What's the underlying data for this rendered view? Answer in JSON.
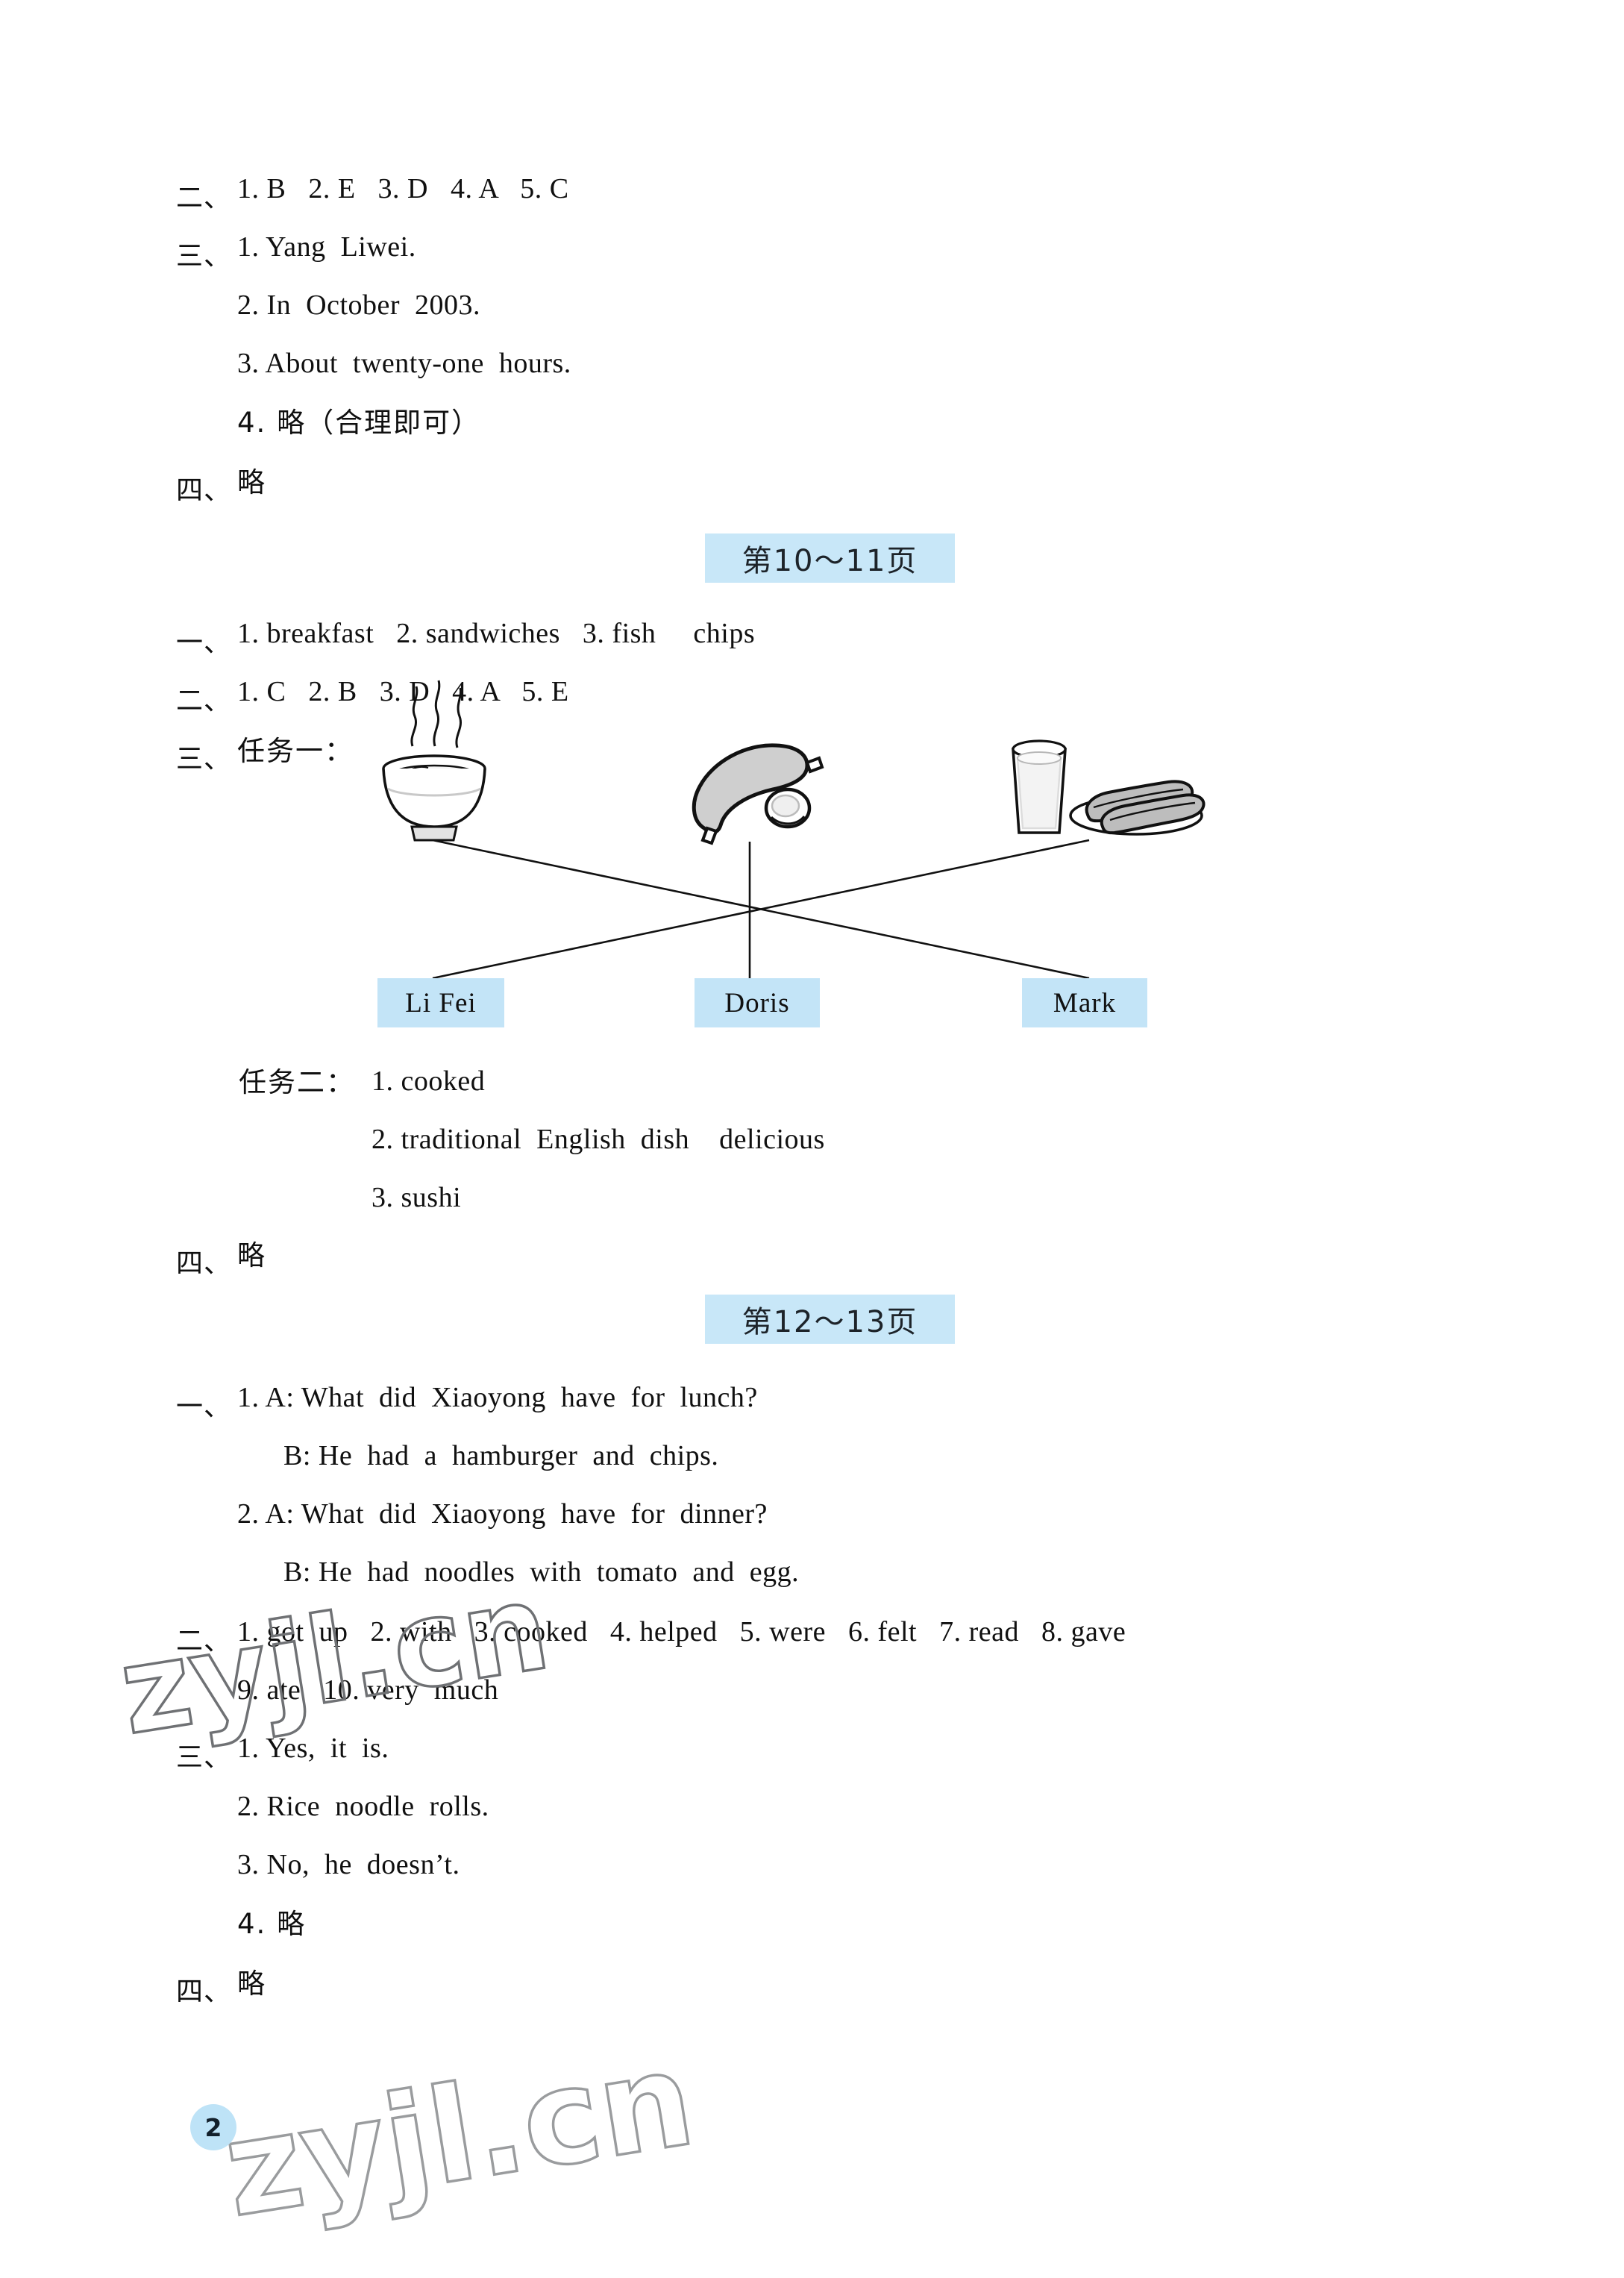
{
  "document": {
    "page_number": "2",
    "watermark_text": "zyjl.cn"
  },
  "section_top": {
    "lines": [
      {
        "marker": "二、",
        "text": "1. B   2. E   3. D   4. A   5. C"
      },
      {
        "marker": "三、",
        "text": "1. Yang  Liwei."
      },
      {
        "marker": "",
        "text": "2. In  October  2003."
      },
      {
        "marker": "",
        "text": "3. About  twenty-one  hours."
      },
      {
        "marker": "",
        "text": "4. 略（合理即可）"
      },
      {
        "marker": "四、",
        "text": "略"
      }
    ]
  },
  "page_heading_1": {
    "label": "第10～11页"
  },
  "section_10_11": {
    "line_1": {
      "marker": "一、",
      "text": "1. breakfast   2. sandwiches   3. fish     chips"
    },
    "line_2": {
      "marker": "二、",
      "text": "1. C   2. B   3. D   4. A   5. E"
    },
    "task_one_marker": "三、",
    "task_one_label": "任务一：",
    "food_items": [
      {
        "name": "noodle-soup-bowl",
        "label": "noodle soup bowl with steam"
      },
      {
        "name": "sausage-and-egg",
        "label": "sausage and fried egg"
      },
      {
        "name": "milk-and-dough-sticks",
        "label": "glass of milk and plate of fried dough sticks"
      }
    ],
    "name_chips": [
      {
        "name": "li-fei",
        "label": "Li  Fei"
      },
      {
        "name": "doris",
        "label": "Doris"
      },
      {
        "name": "mark",
        "label": "Mark"
      }
    ],
    "matching_lines": [
      {
        "from": "noodle-soup-bowl",
        "to": "mark"
      },
      {
        "from": "sausage-and-egg",
        "to": "doris"
      },
      {
        "from": "milk-and-dough-sticks",
        "to": "li-fei"
      }
    ],
    "task_two_label": "任务二：",
    "task_two_items": [
      "1. cooked",
      "2. traditional  English  dish    delicious",
      "3. sushi"
    ],
    "line_4": {
      "marker": "四、",
      "text": "略"
    }
  },
  "page_heading_2": {
    "label": "第12～13页"
  },
  "section_12_13": {
    "group_one_marker": "一、",
    "group_one": [
      "1. A: What  did  Xiaoyong  have  for  lunch?",
      "B: He  had  a  hamburger  and  chips.",
      "2. A: What  did  Xiaoyong  have  for  dinner?",
      "B: He  had  noodles  with  tomato  and  egg."
    ],
    "group_two_marker": "二、",
    "group_two": [
      "1. got  up   2. with   3. cooked   4. helped   5. were   6. felt   7. read   8. gave",
      "9. ate   10. very  much"
    ],
    "group_three_marker": "三、",
    "group_three": [
      "1. Yes,  it  is.",
      "2. Rice  noodle  rolls.",
      "3. No,  he  doesn’t.",
      "4. 略"
    ],
    "group_four": {
      "marker": "四、",
      "text": "略"
    }
  },
  "colors": {
    "chip_blue": "#c8e7f8",
    "name_chip_blue": "#c3e4f7",
    "page_bubble_blue": "#bee3f7",
    "text": "#101010",
    "line": "#111111"
  }
}
